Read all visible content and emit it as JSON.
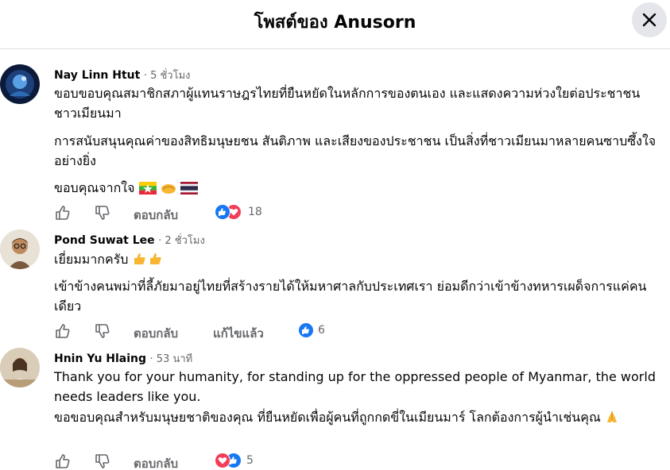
{
  "header": {
    "title": "โพสต์ของ Anusorn"
  },
  "colors": {
    "like": "#1877f2",
    "love": "#f33e58",
    "muted": "#65676b",
    "close_bg": "#e4e6eb"
  },
  "comments": [
    {
      "author": "Nay Linn Htut",
      "time": "5 ชั่วโมง",
      "paragraphs": [
        "ขอบขอบคุณสมาชิกสภาผู้แทนราษฎรไทยที่ยืนหยัดในหลักการของตนเอง และแสดงความห่วงใยต่อประชาชนชาวเมียนมา",
        "การสนับสนุนคุณค่าของสิทธิมนุษยชน สันติภาพ และเสียงของประชาชน เป็นสิ่งที่ชาวเมียนมาหลายคนซาบซึ้งใจอย่างยิ่ง",
        "ขอบคุณจากใจ"
      ],
      "reply_label": "ตอบกลับ",
      "reaction_count": "18",
      "reaction_icons": [
        "like-icon",
        "love-icon"
      ]
    },
    {
      "author": "Pond Suwat Lee",
      "time": "2 ชั่วโมง",
      "paragraphs": [
        "เยี่ยมมากครับ",
        "เข้าข้างคนพม่าที่ลี้ภัยมาอยู่ไทยที่สร้างรายได้ให้มหาศาลกับประเทศเรา ย่อมดีกว่าเข้าข้างทหารเผด็จการแค่คนเดียว"
      ],
      "reply_label": "ตอบกลับ",
      "edited_label": "แก้ไขแล้ว",
      "reaction_count": "6",
      "reaction_icons": [
        "like-icon"
      ]
    },
    {
      "author": "Hnin Yu Hlaing",
      "time": "53 นาที",
      "paragraphs": [
        "Thank you for your humanity, for standing up for the oppressed people of Myanmar, the world needs leaders like you.",
        "ขอขอบคุณสำหรับมนุษยชาติของคุณ ที่ยืนหยัดเพื่อผู้คนที่ถูกกดขี่ในเมียนมาร์ โลกต้องการผู้นำเช่นคุณ"
      ],
      "reply_label": "ตอบกลับ",
      "reaction_count": "5",
      "reaction_icons": [
        "love-icon",
        "like-icon"
      ]
    }
  ]
}
